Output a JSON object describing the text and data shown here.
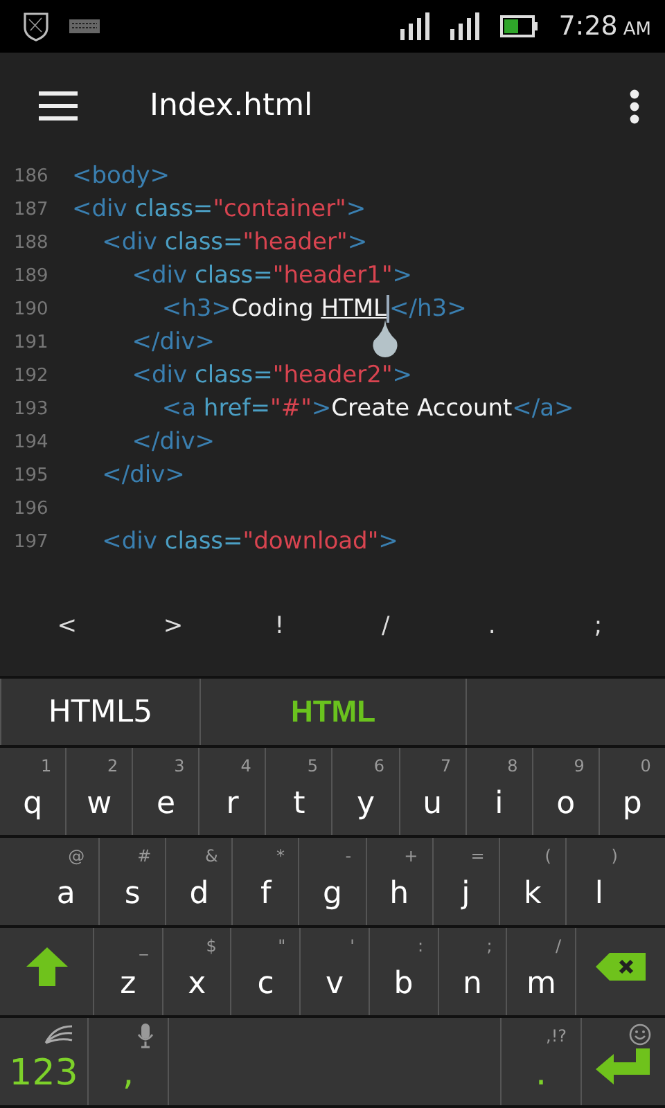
{
  "status_bar": {
    "time": "7:28",
    "ampm": "AM"
  },
  "app_bar": {
    "title": "Index.html"
  },
  "code_lines": [
    {
      "number": "186",
      "segments": [
        {
          "kind": "tag",
          "text": "<body>"
        }
      ]
    },
    {
      "number": "187",
      "segments": [
        {
          "kind": "tag",
          "text": "<div"
        },
        {
          "kind": "attr",
          "text": " class="
        },
        {
          "kind": "string",
          "text": "\"container\""
        },
        {
          "kind": "tag",
          "text": ">"
        }
      ]
    },
    {
      "number": "188",
      "segments": [
        {
          "kind": "tag",
          "text": "    <div"
        },
        {
          "kind": "attr",
          "text": " class="
        },
        {
          "kind": "string",
          "text": "\"header\""
        },
        {
          "kind": "tag",
          "text": ">"
        }
      ]
    },
    {
      "number": "189",
      "segments": [
        {
          "kind": "tag",
          "text": "        <div"
        },
        {
          "kind": "attr",
          "text": " class="
        },
        {
          "kind": "string",
          "text": "\"header1\""
        },
        {
          "kind": "tag",
          "text": ">"
        }
      ]
    },
    {
      "number": "190",
      "segments": [
        {
          "kind": "tag",
          "text": "            <h3>"
        },
        {
          "kind": "text",
          "text": "Coding "
        },
        {
          "kind": "composing",
          "text": "HTML"
        },
        {
          "kind": "tag",
          "text": "</h3>"
        }
      ]
    },
    {
      "number": "191",
      "segments": [
        {
          "kind": "tag",
          "text": "        </div>"
        }
      ]
    },
    {
      "number": "192",
      "segments": [
        {
          "kind": "tag",
          "text": "        <div"
        },
        {
          "kind": "attr",
          "text": " class="
        },
        {
          "kind": "string",
          "text": "\"header2\""
        },
        {
          "kind": "tag",
          "text": ">"
        }
      ]
    },
    {
      "number": "193",
      "segments": [
        {
          "kind": "tag",
          "text": "            <a"
        },
        {
          "kind": "attr",
          "text": " href="
        },
        {
          "kind": "string",
          "text": "\"#\""
        },
        {
          "kind": "tag",
          "text": ">"
        },
        {
          "kind": "text",
          "text": "Create Account"
        },
        {
          "kind": "tag",
          "text": "</a>"
        }
      ]
    },
    {
      "number": "194",
      "segments": [
        {
          "kind": "tag",
          "text": "        </div>"
        }
      ]
    },
    {
      "number": "195",
      "segments": [
        {
          "kind": "tag",
          "text": "    </div>"
        }
      ]
    },
    {
      "number": "196"
    },
    {
      "number": "197",
      "segments": [
        {
          "kind": "tag",
          "text": "    <div"
        },
        {
          "kind": "attr",
          "text": " class="
        },
        {
          "kind": "string",
          "text": "\"download\""
        },
        {
          "kind": "tag",
          "text": ">"
        }
      ]
    }
  ],
  "symbol_bar": [
    "<",
    ">",
    "!",
    "/",
    ".",
    ";"
  ],
  "suggestions": [
    {
      "text": "HTML5",
      "selected": false
    },
    {
      "text": "HTML",
      "selected": true
    }
  ],
  "keyboard": {
    "rows": [
      [
        {
          "kind": "char",
          "label": "q",
          "hint": "1"
        },
        {
          "kind": "char",
          "label": "w",
          "hint": "2"
        },
        {
          "kind": "char",
          "label": "e",
          "hint": "3"
        },
        {
          "kind": "char",
          "label": "r",
          "hint": "4"
        },
        {
          "kind": "char",
          "label": "t",
          "hint": "5"
        },
        {
          "kind": "char",
          "label": "y",
          "hint": "6"
        },
        {
          "kind": "char",
          "label": "u",
          "hint": "7"
        },
        {
          "kind": "char",
          "label": "i",
          "hint": "8"
        },
        {
          "kind": "char",
          "label": "o",
          "hint": "9"
        },
        {
          "kind": "char",
          "label": "p",
          "hint": "0"
        }
      ],
      [
        {
          "kind": "char",
          "label": "a",
          "hint": "@"
        },
        {
          "kind": "char",
          "label": "s",
          "hint": "#"
        },
        {
          "kind": "char",
          "label": "d",
          "hint": "&"
        },
        {
          "kind": "char",
          "label": "f",
          "hint": "*"
        },
        {
          "kind": "char",
          "label": "g",
          "hint": "-"
        },
        {
          "kind": "char",
          "label": "h",
          "hint": "+"
        },
        {
          "kind": "char",
          "label": "j",
          "hint": "="
        },
        {
          "kind": "char",
          "label": "k",
          "hint": "("
        },
        {
          "kind": "char",
          "label": "l",
          "hint": ")"
        }
      ],
      [
        {
          "kind": "shift"
        },
        {
          "kind": "char",
          "label": "z",
          "hint": "_"
        },
        {
          "kind": "char",
          "label": "x",
          "hint": "$"
        },
        {
          "kind": "char",
          "label": "c",
          "hint": "\""
        },
        {
          "kind": "char",
          "label": "v",
          "hint": "'"
        },
        {
          "kind": "char",
          "label": "b",
          "hint": ":"
        },
        {
          "kind": "char",
          "label": "n",
          "hint": ";"
        },
        {
          "kind": "char",
          "label": "m",
          "hint": "/"
        },
        {
          "kind": "backspace"
        }
      ],
      [
        {
          "kind": "numbers",
          "label": "123"
        },
        {
          "kind": "comma",
          "label": ","
        },
        {
          "kind": "space"
        },
        {
          "kind": "period",
          "label": ".",
          "hint": ",!?"
        },
        {
          "kind": "enter"
        }
      ]
    ]
  }
}
